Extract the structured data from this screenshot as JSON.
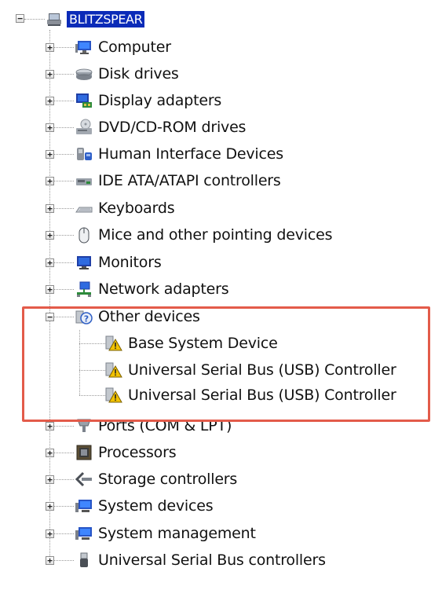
{
  "tree": {
    "root": {
      "label": "BLITZSPEAR",
      "icon": "computer-tree-root-icon",
      "toggle": "−"
    },
    "categories": [
      {
        "label": "Computer",
        "icon": "computer-icon",
        "toggle": "+"
      },
      {
        "label": "Disk drives",
        "icon": "disk-drive-icon",
        "toggle": "+"
      },
      {
        "label": "Display adapters",
        "icon": "display-adapter-icon",
        "toggle": "+"
      },
      {
        "label": "DVD/CD-ROM drives",
        "icon": "dvd-drive-icon",
        "toggle": "+"
      },
      {
        "label": "Human Interface Devices",
        "icon": "hid-icon",
        "toggle": "+"
      },
      {
        "label": "IDE ATA/ATAPI controllers",
        "icon": "ide-controller-icon",
        "toggle": "+"
      },
      {
        "label": "Keyboards",
        "icon": "keyboard-icon",
        "toggle": "+"
      },
      {
        "label": "Mice and other pointing devices",
        "icon": "mouse-icon",
        "toggle": "+"
      },
      {
        "label": "Monitors",
        "icon": "monitor-icon",
        "toggle": "+"
      },
      {
        "label": "Network adapters",
        "icon": "network-adapter-icon",
        "toggle": "+"
      },
      {
        "label": "Other devices",
        "icon": "unknown-device-icon",
        "toggle": "−",
        "children": [
          {
            "label": "Base System Device",
            "icon": "warning-device-icon"
          },
          {
            "label": "Universal Serial Bus (USB) Controller",
            "icon": "warning-device-icon"
          },
          {
            "label": "Universal Serial Bus (USB) Controller",
            "icon": "warning-device-icon"
          }
        ]
      },
      {
        "label": "Ports (COM & LPT)",
        "icon": "port-icon",
        "toggle": "+"
      },
      {
        "label": "Processors",
        "icon": "processor-icon",
        "toggle": "+"
      },
      {
        "label": "Storage controllers",
        "icon": "storage-controller-icon",
        "toggle": "+"
      },
      {
        "label": "System devices",
        "icon": "system-device-icon",
        "toggle": "+"
      },
      {
        "label": "System management",
        "icon": "system-management-icon",
        "toggle": "+"
      },
      {
        "label": "Universal Serial Bus controllers",
        "icon": "usb-icon",
        "toggle": "+"
      }
    ]
  },
  "colors": {
    "selection": "#0b2bb8",
    "highlight_border": "#e35b4a",
    "warning": "#f2c200"
  }
}
